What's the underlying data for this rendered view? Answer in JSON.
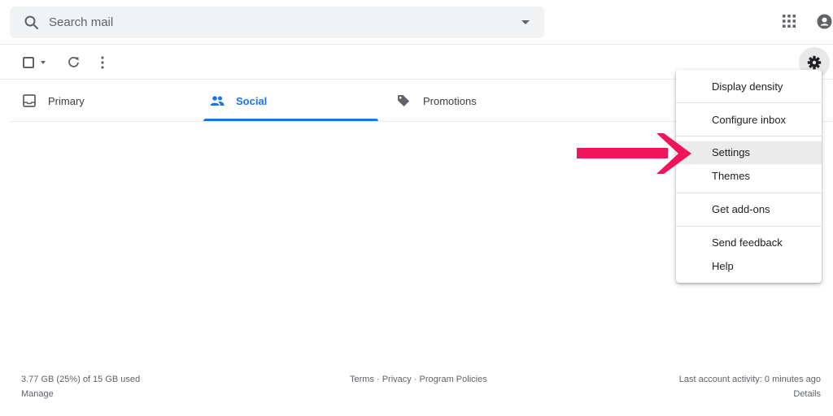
{
  "search": {
    "placeholder": "Search mail"
  },
  "tabs": [
    {
      "label": "Primary",
      "icon": "inbox-icon"
    },
    {
      "label": "Social",
      "icon": "people-icon",
      "selected": true
    },
    {
      "label": "Promotions",
      "icon": "tag-icon"
    }
  ],
  "settings_menu": {
    "items": [
      {
        "label": "Display density"
      },
      {
        "label": "Configure inbox"
      },
      {
        "label": "Settings",
        "highlighted": true
      },
      {
        "label": "Themes"
      },
      {
        "label": "Get add-ons"
      },
      {
        "label": "Send feedback"
      },
      {
        "label": "Help"
      }
    ]
  },
  "footer": {
    "storage": "3.77 GB (25%) of 15 GB used",
    "manage": "Manage",
    "policies": "Terms · Privacy · Program Policies",
    "last_activity": "Last account activity: 0 minutes ago",
    "details": "Details"
  },
  "colors": {
    "accent": "#1a73e8",
    "annotation_arrow": "#f0145a",
    "search_bg": "#f1f3f4"
  }
}
